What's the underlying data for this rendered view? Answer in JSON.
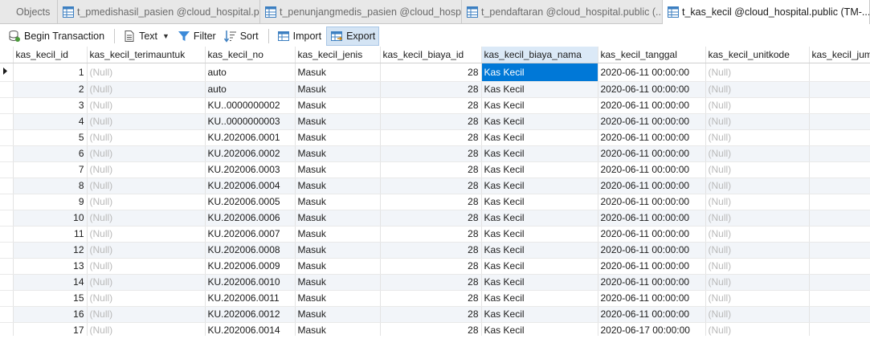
{
  "tabs": [
    {
      "label": "Objects",
      "active": false,
      "icon": "none"
    },
    {
      "label": "t_pmedishasil_pasien @cloud_hospital.p...",
      "active": false,
      "icon": "table-icon"
    },
    {
      "label": "t_penunjangmedis_pasien @cloud_hosp...",
      "active": false,
      "icon": "table-icon"
    },
    {
      "label": "t_pendaftaran @cloud_hospital.public (...",
      "active": false,
      "icon": "table-icon"
    },
    {
      "label": "t_kas_kecil @cloud_hospital.public (TM-...",
      "active": true,
      "icon": "table-icon"
    }
  ],
  "toolbar": {
    "begin_transaction": "Begin Transaction",
    "text": "Text",
    "filter": "Filter",
    "sort": "Sort",
    "import": "Import",
    "export": "Export"
  },
  "columns": [
    "kas_kecil_id",
    "kas_kecil_terimauntuk",
    "kas_kecil_no",
    "kas_kecil_jenis",
    "kas_kecil_biaya_id",
    "kas_kecil_biaya_nama",
    "kas_kecil_tanggal",
    "kas_kecil_unitkode",
    "kas_kecil_juml"
  ],
  "rows": [
    [
      "1",
      "(Null)",
      "auto",
      "Masuk",
      "28",
      "Kas Kecil",
      "2020-06-11 00:00:00",
      "(Null)",
      ""
    ],
    [
      "2",
      "(Null)",
      "auto",
      "Masuk",
      "28",
      "Kas Kecil",
      "2020-06-11 00:00:00",
      "(Null)",
      ""
    ],
    [
      "3",
      "(Null)",
      "KU..0000000002",
      "Masuk",
      "28",
      "Kas Kecil",
      "2020-06-11 00:00:00",
      "(Null)",
      ""
    ],
    [
      "4",
      "(Null)",
      "KU..0000000003",
      "Masuk",
      "28",
      "Kas Kecil",
      "2020-06-11 00:00:00",
      "(Null)",
      ""
    ],
    [
      "5",
      "(Null)",
      "KU.202006.0001",
      "Masuk",
      "28",
      "Kas Kecil",
      "2020-06-11 00:00:00",
      "(Null)",
      ""
    ],
    [
      "6",
      "(Null)",
      "KU.202006.0002",
      "Masuk",
      "28",
      "Kas Kecil",
      "2020-06-11 00:00:00",
      "(Null)",
      ""
    ],
    [
      "7",
      "(Null)",
      "KU.202006.0003",
      "Masuk",
      "28",
      "Kas Kecil",
      "2020-06-11 00:00:00",
      "(Null)",
      ""
    ],
    [
      "8",
      "(Null)",
      "KU.202006.0004",
      "Masuk",
      "28",
      "Kas Kecil",
      "2020-06-11 00:00:00",
      "(Null)",
      ""
    ],
    [
      "9",
      "(Null)",
      "KU.202006.0005",
      "Masuk",
      "28",
      "Kas Kecil",
      "2020-06-11 00:00:00",
      "(Null)",
      ""
    ],
    [
      "10",
      "(Null)",
      "KU.202006.0006",
      "Masuk",
      "28",
      "Kas Kecil",
      "2020-06-11 00:00:00",
      "(Null)",
      ""
    ],
    [
      "11",
      "(Null)",
      "KU.202006.0007",
      "Masuk",
      "28",
      "Kas Kecil",
      "2020-06-11 00:00:00",
      "(Null)",
      ""
    ],
    [
      "12",
      "(Null)",
      "KU.202006.0008",
      "Masuk",
      "28",
      "Kas Kecil",
      "2020-06-11 00:00:00",
      "(Null)",
      ""
    ],
    [
      "13",
      "(Null)",
      "KU.202006.0009",
      "Masuk",
      "28",
      "Kas Kecil",
      "2020-06-11 00:00:00",
      "(Null)",
      ""
    ],
    [
      "14",
      "(Null)",
      "KU.202006.0010",
      "Masuk",
      "28",
      "Kas Kecil",
      "2020-06-11 00:00:00",
      "(Null)",
      ""
    ],
    [
      "15",
      "(Null)",
      "KU.202006.0011",
      "Masuk",
      "28",
      "Kas Kecil",
      "2020-06-11 00:00:00",
      "(Null)",
      ""
    ],
    [
      "16",
      "(Null)",
      "KU.202006.0012",
      "Masuk",
      "28",
      "Kas Kecil",
      "2020-06-11 00:00:00",
      "(Null)",
      ""
    ],
    [
      "17",
      "(Null)",
      "KU.202006.0014",
      "Masuk",
      "28",
      "Kas Kecil",
      "2020-06-17 00:00:00",
      "(Null)",
      ""
    ]
  ],
  "selected_cell": {
    "row": 0,
    "column": "kas_kecil_biaya_nama"
  },
  "colors": {
    "selection": "#0078d7",
    "null_text": "#b9b9b9",
    "row_alt": "#f2f5f9"
  }
}
